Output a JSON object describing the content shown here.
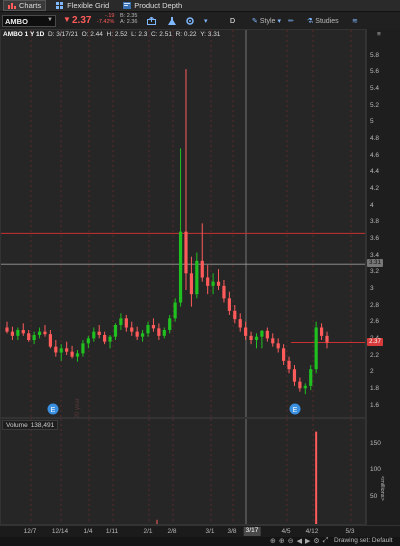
{
  "tabs": [
    {
      "label": "Charts",
      "icon": "bar-chart-icon",
      "active": true
    },
    {
      "label": "Flexible Grid",
      "icon": "grid-icon",
      "active": false
    },
    {
      "label": "Product Depth",
      "icon": "depth-icon",
      "active": false
    }
  ],
  "toolbar": {
    "symbol": "AMBO",
    "last": "2.37",
    "change": "-.19",
    "change_pct": "-7.42%",
    "bid": "B: 2.35",
    "ask": "A: 2.36",
    "aggregation": "D",
    "style_label": "Style",
    "studies_label": "Studies"
  },
  "chart_title": {
    "symbol_period": "AMBO 1 Y 1D",
    "date": "D: 3/17/21",
    "open": "O: 2.44",
    "high": "H: 2.52",
    "low": "L: 2.3",
    "close": "C: 2.51",
    "range": "R: 0.22",
    "year": "Y: 3.31"
  },
  "price_scale": [
    "5.8",
    "5.6",
    "5.4",
    "5.2",
    "5",
    "4.8",
    "4.6",
    "4.4",
    "4.2",
    "4",
    "3.8",
    "3.6",
    "3.4",
    "3.2",
    "3",
    "2.8",
    "2.6",
    "2.4",
    "2.2",
    "2",
    "1.8",
    "1.6"
  ],
  "price_tags": {
    "ref": "3.31",
    "last": "2.37"
  },
  "volume": {
    "label": "Volume",
    "value": "138,491",
    "scale": [
      "150",
      "100",
      "50"
    ],
    "unit": "<millions>"
  },
  "x_axis": [
    "12/7",
    "12/14",
    "1/4",
    "1/11",
    "2/1",
    "2/8",
    "3/1",
    "3/8",
    "4/5",
    "4/12",
    "5/3"
  ],
  "x_highlight": "3/17",
  "vertical_labels": [
    "2020 year"
  ],
  "status": {
    "drawing_set": "Drawing set: Default"
  },
  "colors": {
    "up": "#1fc01f",
    "down": "#ff5b5b",
    "bg": "#262626",
    "hline": "#c83232",
    "ref": "#9a9a9a"
  },
  "chart_data": {
    "type": "candlestick",
    "series": [
      {
        "name": "AMBO",
        "ohlc": [
          [
            2.55,
            2.62,
            2.48,
            2.5
          ],
          [
            2.5,
            2.56,
            2.4,
            2.45
          ],
          [
            2.45,
            2.55,
            2.4,
            2.52
          ],
          [
            2.52,
            2.6,
            2.45,
            2.48
          ],
          [
            2.48,
            2.52,
            2.38,
            2.4
          ],
          [
            2.4,
            2.5,
            2.35,
            2.46
          ],
          [
            2.46,
            2.55,
            2.42,
            2.5
          ],
          [
            2.5,
            2.58,
            2.44,
            2.47
          ],
          [
            2.47,
            2.52,
            2.3,
            2.32
          ],
          [
            2.32,
            2.4,
            2.2,
            2.25
          ],
          [
            2.25,
            2.35,
            2.15,
            2.3
          ],
          [
            2.3,
            2.38,
            2.22,
            2.26
          ],
          [
            2.26,
            2.33,
            2.18,
            2.2
          ],
          [
            2.2,
            2.28,
            2.14,
            2.24
          ],
          [
            2.24,
            2.4,
            2.2,
            2.36
          ],
          [
            2.36,
            2.45,
            2.3,
            2.42
          ],
          [
            2.42,
            2.55,
            2.38,
            2.5
          ],
          [
            2.5,
            2.58,
            2.42,
            2.46
          ],
          [
            2.46,
            2.5,
            2.35,
            2.38
          ],
          [
            2.38,
            2.46,
            2.3,
            2.44
          ],
          [
            2.44,
            2.6,
            2.4,
            2.58
          ],
          [
            2.58,
            2.72,
            2.52,
            2.66
          ],
          [
            2.66,
            2.7,
            2.5,
            2.55
          ],
          [
            2.55,
            2.62,
            2.45,
            2.5
          ],
          [
            2.5,
            2.56,
            2.4,
            2.44
          ],
          [
            2.44,
            2.52,
            2.38,
            2.48
          ],
          [
            2.48,
            2.62,
            2.44,
            2.58
          ],
          [
            2.58,
            2.66,
            2.5,
            2.54
          ],
          [
            2.54,
            2.6,
            2.4,
            2.45
          ],
          [
            2.45,
            2.55,
            2.42,
            2.52
          ],
          [
            2.52,
            2.7,
            2.48,
            2.66
          ],
          [
            2.66,
            2.9,
            2.62,
            2.85
          ],
          [
            2.85,
            4.7,
            2.8,
            3.7
          ],
          [
            3.7,
            5.65,
            3.0,
            3.2
          ],
          [
            3.2,
            3.4,
            2.8,
            2.95
          ],
          [
            2.95,
            3.45,
            2.9,
            3.35
          ],
          [
            3.35,
            3.8,
            3.1,
            3.15
          ],
          [
            3.15,
            3.3,
            2.95,
            3.05
          ],
          [
            3.05,
            3.2,
            2.95,
            3.1
          ],
          [
            3.1,
            3.25,
            3.0,
            3.05
          ],
          [
            3.05,
            3.12,
            2.85,
            2.9
          ],
          [
            2.9,
            2.98,
            2.7,
            2.75
          ],
          [
            2.75,
            2.82,
            2.6,
            2.65
          ],
          [
            2.65,
            2.72,
            2.5,
            2.55
          ],
          [
            2.55,
            2.62,
            2.4,
            2.45
          ],
          [
            2.45,
            2.5,
            2.35,
            2.4
          ],
          [
            2.4,
            2.48,
            2.3,
            2.44
          ],
          [
            2.44,
            2.52,
            2.3,
            2.51
          ],
          [
            2.51,
            2.55,
            2.38,
            2.42
          ],
          [
            2.42,
            2.48,
            2.32,
            2.36
          ],
          [
            2.36,
            2.42,
            2.25,
            2.3
          ],
          [
            2.3,
            2.35,
            2.1,
            2.15
          ],
          [
            2.15,
            2.2,
            2.0,
            2.05
          ],
          [
            2.05,
            2.1,
            1.85,
            1.9
          ],
          [
            1.9,
            1.95,
            1.78,
            1.82
          ],
          [
            1.82,
            1.88,
            1.75,
            1.85
          ],
          [
            1.85,
            2.1,
            1.8,
            2.05
          ],
          [
            2.05,
            2.62,
            2.0,
            2.55
          ],
          [
            2.55,
            2.6,
            2.4,
            2.45
          ],
          [
            2.45,
            2.5,
            2.3,
            2.37
          ]
        ]
      }
    ],
    "x_tick_labels": [
      "12/7",
      "12/14",
      "1/4",
      "1/11",
      "2/1",
      "2/8",
      "3/1",
      "3/8",
      "4/5",
      "4/12",
      "5/3"
    ],
    "ylim": [
      1.5,
      6.0
    ],
    "reference_lines": [
      3.31,
      3.68
    ],
    "volume_millions": [
      0,
      0,
      0,
      0,
      0,
      0,
      0,
      0,
      0,
      0,
      0,
      0,
      0,
      0,
      0,
      0,
      0,
      0,
      0,
      0,
      0,
      0,
      0,
      0,
      0,
      0,
      0,
      0,
      0,
      0,
      0,
      0,
      0,
      0,
      0,
      0,
      0,
      0,
      0,
      0,
      0,
      0,
      0,
      0,
      0,
      0,
      0,
      0,
      0,
      0,
      0,
      0,
      0,
      0,
      0,
      0,
      0,
      175,
      0,
      0
    ],
    "volume_ylim": [
      0,
      180
    ]
  }
}
